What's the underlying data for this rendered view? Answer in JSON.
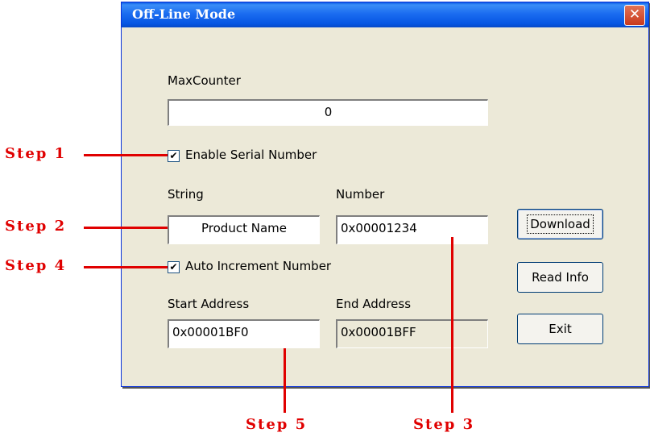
{
  "window": {
    "title": "Off-Line Mode",
    "close_symbol": "✕"
  },
  "max_counter": {
    "label": "MaxCounter",
    "value": "0"
  },
  "serial": {
    "label": "Enable Serial Number",
    "checked": true,
    "check_glyph": "✔"
  },
  "string_field": {
    "label": "String",
    "value": "Product Name"
  },
  "number_field": {
    "label": "Number",
    "value": "0x00001234"
  },
  "auto_increment": {
    "label": "Auto Increment Number",
    "checked": true,
    "check_glyph": "✔"
  },
  "start_address": {
    "label": "Start Address",
    "value": "0x00001BF0"
  },
  "end_address": {
    "label": "End Address",
    "value": "0x00001BFF"
  },
  "buttons": {
    "download": "Download",
    "read_info": "Read Info",
    "exit": "Exit"
  },
  "annotations": {
    "step1": "Step 1",
    "step2": "Step 2",
    "step3": "Step 3",
    "step4": "Step 4",
    "step5": "Step 5"
  },
  "colors": {
    "annotation": "#E00000",
    "titlebar": "#0656E3",
    "dialog_bg": "#ECE9D8"
  }
}
